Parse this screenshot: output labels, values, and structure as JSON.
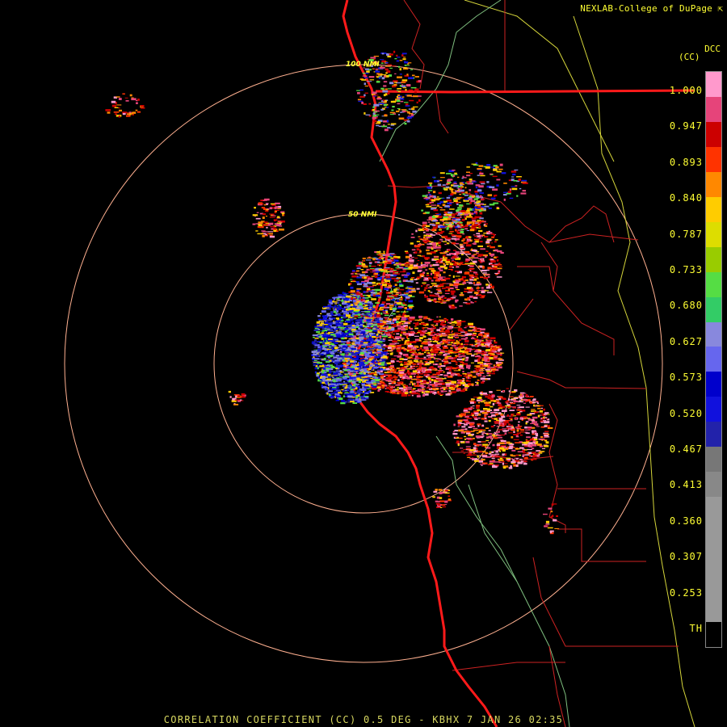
{
  "header": {
    "credit": "NEXLAB-College of DuPage",
    "logo_glyph": "⇱"
  },
  "legend": {
    "product_code": "DCC",
    "unit": "(CC)",
    "ticks": [
      "1.000",
      "0.947",
      "0.893",
      "0.840",
      "0.787",
      "0.733",
      "0.680",
      "0.627",
      "0.573",
      "0.520",
      "0.467",
      "0.413",
      "0.360",
      "0.307",
      "0.253",
      "TH"
    ],
    "colors": [
      "#ff99cc",
      "#e6447a",
      "#cc0000",
      "#ff3300",
      "#ff8800",
      "#ffcc00",
      "#dddd00",
      "#99cc00",
      "#55dd44",
      "#33cc66",
      "#8888dd",
      "#6666ee",
      "#0000cc",
      "#1111dd",
      "#2222aa",
      "#777777",
      "#888888",
      "#999999",
      "#999999",
      "#999999",
      "#999999",
      "#999999",
      "#000000"
    ]
  },
  "range_rings": {
    "inner_label": "50 NMI",
    "outer_label": "100 NMI"
  },
  "footer": {
    "caption": "CORRELATION COEFFICIENT (CC) 0.5 DEG - KBHX 7 JAN 26 02:35"
  },
  "colors": {
    "coast": "#ff1a1a",
    "state_border": "#ff1a1a",
    "county": "#cc2222",
    "hydro": "#7fbf7f",
    "boundary_yellow": "#d4d43a",
    "ring": "#ffb090"
  }
}
